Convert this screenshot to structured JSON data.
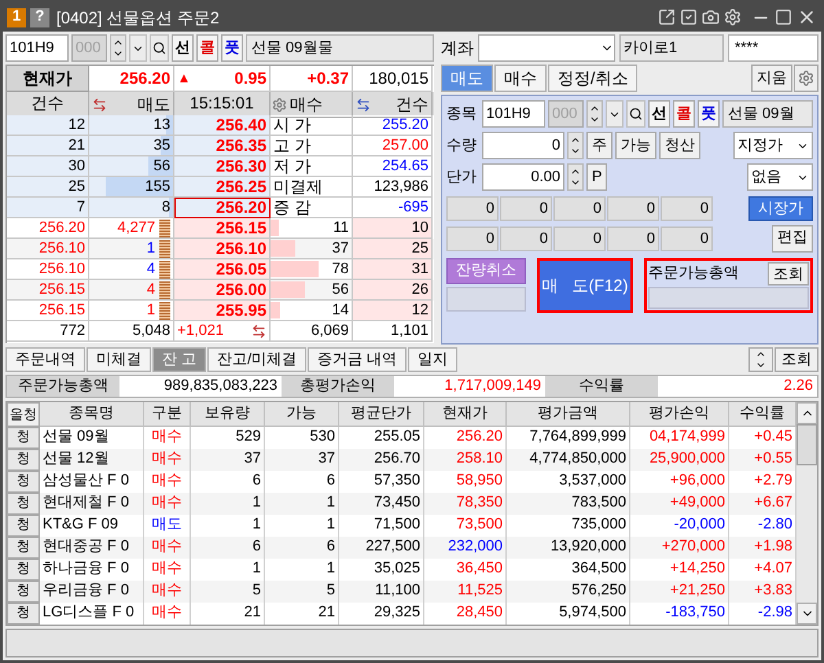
{
  "window": {
    "badge": "1",
    "help": "?",
    "title": "[0402] 선물옵션 주문2"
  },
  "left": {
    "symbol": {
      "code": "101H9",
      "sub": "000",
      "buttons": [
        {
          "label": "선",
          "kind": "futures"
        },
        {
          "label": "콜",
          "kind": "call"
        },
        {
          "label": "풋",
          "kind": "put"
        }
      ],
      "name": "선물 09월물"
    },
    "quote": {
      "label": "현재가",
      "price": "256.20",
      "arrow": "▲",
      "change": "0.95",
      "rate": "+0.37",
      "volume": "180,015"
    },
    "book_header": {
      "ask_count": "건수",
      "ask": "매도",
      "time": "15:15:01",
      "bid": "매수",
      "bid_count": "건수"
    },
    "asks": [
      {
        "count": "12",
        "qty": "13",
        "level": 0.08,
        "price": "256.40",
        "current": false,
        "info_label": "시 가",
        "info_value": "255.20",
        "color": "#0000ff"
      },
      {
        "count": "21",
        "qty": "35",
        "level": 0.15,
        "price": "256.35",
        "current": false,
        "info_label": "고 가",
        "info_value": "257.00",
        "color": "#ff0000"
      },
      {
        "count": "30",
        "qty": "56",
        "level": 0.3,
        "price": "256.30",
        "current": false,
        "info_label": "저 가",
        "info_value": "254.65",
        "color": "#0000ff"
      },
      {
        "count": "25",
        "qty": "155",
        "level": 0.8,
        "price": "256.25",
        "current": false,
        "info_label": "미결제",
        "info_value": "123,986",
        "color": "#000000"
      },
      {
        "count": "7",
        "qty": "8",
        "level": 0.05,
        "price": "256.20",
        "current": true,
        "info_label": "증 감",
        "info_value": "-695",
        "color": "#0000ff"
      }
    ],
    "bids": [
      {
        "trade_price": "256.20",
        "trade_qty": "4,277",
        "color": "#ff0000",
        "price": "256.15",
        "qty": "11",
        "level": 0.1,
        "count": "10"
      },
      {
        "trade_price": "256.10",
        "trade_qty": "1",
        "color": "#0000ff",
        "price": "256.10",
        "qty": "37",
        "level": 0.3,
        "count": "25"
      },
      {
        "trade_price": "256.10",
        "trade_qty": "4",
        "color": "#0000ff",
        "price": "256.05",
        "qty": "78",
        "level": 0.6,
        "count": "31"
      },
      {
        "trade_price": "256.15",
        "trade_qty": "4",
        "color": "#ff0000",
        "price": "256.00",
        "qty": "56",
        "level": 0.43,
        "count": "26"
      },
      {
        "trade_price": "256.15",
        "trade_qty": "1",
        "color": "#ff0000",
        "price": "255.95",
        "qty": "14",
        "level": 0.12,
        "count": "12"
      }
    ],
    "totals": {
      "ask_count": "772",
      "ask_qty": "5,048",
      "diff": "+1,021",
      "bid_qty": "6,069",
      "bid_count": "1,101"
    }
  },
  "right": {
    "account_label": "계좌",
    "account_name": "카이로1",
    "password": "****",
    "tabs": [
      {
        "label": "매도",
        "selected": true
      },
      {
        "label": "매수",
        "selected": false
      },
      {
        "label": "정정/취소",
        "selected": false
      }
    ],
    "clear_button": "지움",
    "symbol": {
      "label": "종목",
      "code": "101H9",
      "sub": "000",
      "buttons": [
        {
          "label": "선",
          "kind": "futures"
        },
        {
          "label": "콜",
          "kind": "call"
        },
        {
          "label": "풋",
          "kind": "put"
        }
      ],
      "name": "선물 09월"
    },
    "qty": {
      "label": "수량",
      "value": "0",
      "buttons": [
        "주",
        "가능",
        "청산"
      ],
      "type": "지정가"
    },
    "price": {
      "label": "단가",
      "value": "0.00",
      "button": "P",
      "condition": "없음"
    },
    "grid": [
      [
        "0",
        "0",
        "0",
        "0",
        "0"
      ],
      [
        "0",
        "0",
        "0",
        "0",
        "0"
      ]
    ],
    "market_button": "시장가",
    "edit_button": "편집",
    "cancel_rest_button": "잔량취소",
    "sell_button": "매   도(F12)",
    "available_label": "주문가능총액",
    "query_button": "조회"
  },
  "bottom": {
    "tabs": [
      {
        "label": "주문내역",
        "selected": false
      },
      {
        "label": "미체결",
        "selected": false
      },
      {
        "label": "잔 고",
        "selected": true
      },
      {
        "label": "잔고/미체결",
        "selected": false
      },
      {
        "label": "증거금 내역",
        "selected": false
      },
      {
        "label": "일지",
        "selected": false
      }
    ],
    "query_button": "조회",
    "summary": {
      "available_label": "주문가능총액",
      "available": "989,835,083,223",
      "pl_label": "총평가손익",
      "pl": "1,717,009,149",
      "rate_label": "수익률",
      "rate": "2.26"
    },
    "table": {
      "columns": [
        "올청",
        "종목명",
        "구분",
        "보유량",
        "가능",
        "평균단가",
        "현재가",
        "평가금액",
        "평가손익",
        "수익률"
      ],
      "rows": [
        {
          "button": "청",
          "name": "선물 09월",
          "side": {
            "text": "매수",
            "color": "#ff0000"
          },
          "qty": "529",
          "avail": "530",
          "avg": "255.05",
          "current": {
            "text": "256.20",
            "color": "#ff0000"
          },
          "amount": "7,764,899,999",
          "pl": {
            "text": "04,174,999",
            "color": "#ff0000"
          },
          "rate": {
            "text": "+0.45",
            "color": "#ff0000"
          }
        },
        {
          "button": "청",
          "name": "선물 12월",
          "side": {
            "text": "매수",
            "color": "#ff0000"
          },
          "qty": "37",
          "avail": "37",
          "avg": "256.70",
          "current": {
            "text": "258.10",
            "color": "#ff0000"
          },
          "amount": "4,774,850,000",
          "pl": {
            "text": "25,900,000",
            "color": "#ff0000"
          },
          "rate": {
            "text": "+0.55",
            "color": "#ff0000"
          }
        },
        {
          "button": "청",
          "name": "삼성물산 F 0",
          "side": {
            "text": "매수",
            "color": "#ff0000"
          },
          "qty": "6",
          "avail": "6",
          "avg": "57,350",
          "current": {
            "text": "58,950",
            "color": "#ff0000"
          },
          "amount": "3,537,000",
          "pl": {
            "text": "+96,000",
            "color": "#ff0000"
          },
          "rate": {
            "text": "+2.79",
            "color": "#ff0000"
          }
        },
        {
          "button": "청",
          "name": "현대제철 F 0",
          "side": {
            "text": "매수",
            "color": "#ff0000"
          },
          "qty": "1",
          "avail": "1",
          "avg": "73,450",
          "current": {
            "text": "78,350",
            "color": "#ff0000"
          },
          "amount": "783,500",
          "pl": {
            "text": "+49,000",
            "color": "#ff0000"
          },
          "rate": {
            "text": "+6.67",
            "color": "#ff0000"
          }
        },
        {
          "button": "청",
          "name": "KT&G F 09",
          "side": {
            "text": "매도",
            "color": "#0000ff"
          },
          "qty": "1",
          "avail": "1",
          "avg": "71,500",
          "current": {
            "text": "73,500",
            "color": "#ff0000"
          },
          "amount": "735,000",
          "pl": {
            "text": "-20,000",
            "color": "#0000ff"
          },
          "rate": {
            "text": "-2.80",
            "color": "#0000ff"
          }
        },
        {
          "button": "청",
          "name": "현대중공 F 0",
          "side": {
            "text": "매수",
            "color": "#ff0000"
          },
          "qty": "6",
          "avail": "6",
          "avg": "227,500",
          "current": {
            "text": "232,000",
            "color": "#0000ff"
          },
          "amount": "13,920,000",
          "pl": {
            "text": "+270,000",
            "color": "#ff0000"
          },
          "rate": {
            "text": "+1.98",
            "color": "#ff0000"
          }
        },
        {
          "button": "청",
          "name": "하나금융 F 0",
          "side": {
            "text": "매수",
            "color": "#ff0000"
          },
          "qty": "1",
          "avail": "1",
          "avg": "35,025",
          "current": {
            "text": "36,450",
            "color": "#ff0000"
          },
          "amount": "364,500",
          "pl": {
            "text": "+14,250",
            "color": "#ff0000"
          },
          "rate": {
            "text": "+4.07",
            "color": "#ff0000"
          }
        },
        {
          "button": "청",
          "name": "우리금융 F 0",
          "side": {
            "text": "매수",
            "color": "#ff0000"
          },
          "qty": "5",
          "avail": "5",
          "avg": "11,100",
          "current": {
            "text": "11,525",
            "color": "#ff0000"
          },
          "amount": "576,250",
          "pl": {
            "text": "+21,250",
            "color": "#ff0000"
          },
          "rate": {
            "text": "+3.83",
            "color": "#ff0000"
          }
        },
        {
          "button": "청",
          "name": "LG디스플 F 0",
          "side": {
            "text": "매수",
            "color": "#ff0000"
          },
          "qty": "21",
          "avail": "21",
          "avg": "29,325",
          "current": {
            "text": "28,450",
            "color": "#ff0000"
          },
          "amount": "5,974,500",
          "pl": {
            "text": "-183,750",
            "color": "#0000ff"
          },
          "rate": {
            "text": "-2.98",
            "color": "#0000ff"
          }
        }
      ]
    }
  }
}
